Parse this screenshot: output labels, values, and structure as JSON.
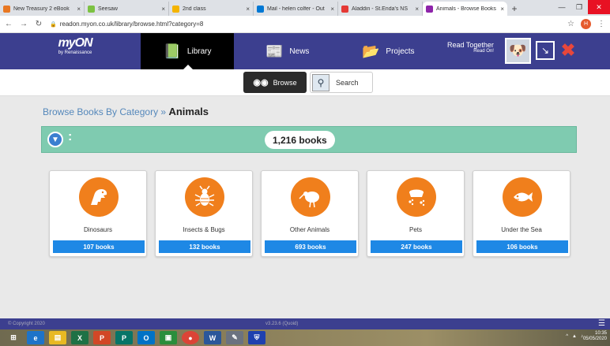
{
  "browser": {
    "tabs": [
      {
        "label": "New Treasury 2 eBook",
        "color": "#e87722"
      },
      {
        "label": "Seesaw",
        "color": "#7cc242"
      },
      {
        "label": "2nd class",
        "color": "#f4b400"
      },
      {
        "label": "Mail - helen colfer - Out",
        "color": "#0078d4"
      },
      {
        "label": "Aladdin - St.Enda's NS",
        "color": "#e53935"
      },
      {
        "label": "Animals - Browse Books",
        "color": "#8e24aa"
      }
    ],
    "tab_close": "×",
    "new_tab": "+",
    "url": "readon.myon.co.uk/library/browse.html?category=8",
    "profile_initial": "H"
  },
  "nav": {
    "logo_main": "myON",
    "logo_sub": "by Renaissance",
    "library": "Library",
    "news": "News",
    "projects": "Projects",
    "read_together": "Read Together",
    "read_on": "Read On!"
  },
  "subbar": {
    "browse": "Browse",
    "search": "Search"
  },
  "breadcrumb": {
    "root": "Browse Books By Category",
    "sep": "»",
    "current": "Animals"
  },
  "count": "1,216 books",
  "categories": [
    {
      "name": "Dinosaurs",
      "count": "107 books",
      "icon": "dinosaur-icon"
    },
    {
      "name": "Insects & Bugs",
      "count": "132 books",
      "icon": "bug-icon"
    },
    {
      "name": "Other Animals",
      "count": "693 books",
      "icon": "kiwi-bird-icon"
    },
    {
      "name": "Pets",
      "count": "247 books",
      "icon": "pet-bowl-icon"
    },
    {
      "name": "Under the Sea",
      "count": "106 books",
      "icon": "fish-icon"
    }
  ],
  "footer": {
    "copyright": "© Copyright 2020",
    "version": "v3.23.6 (Quoid)"
  },
  "taskbar": {
    "time": "10:35",
    "date": "05/05/2020"
  },
  "colors": {
    "nav_bg": "#3c3f8f",
    "accent_orange": "#f07f1c",
    "button_blue": "#1e88e5",
    "count_bar": "#7fcbb0"
  }
}
